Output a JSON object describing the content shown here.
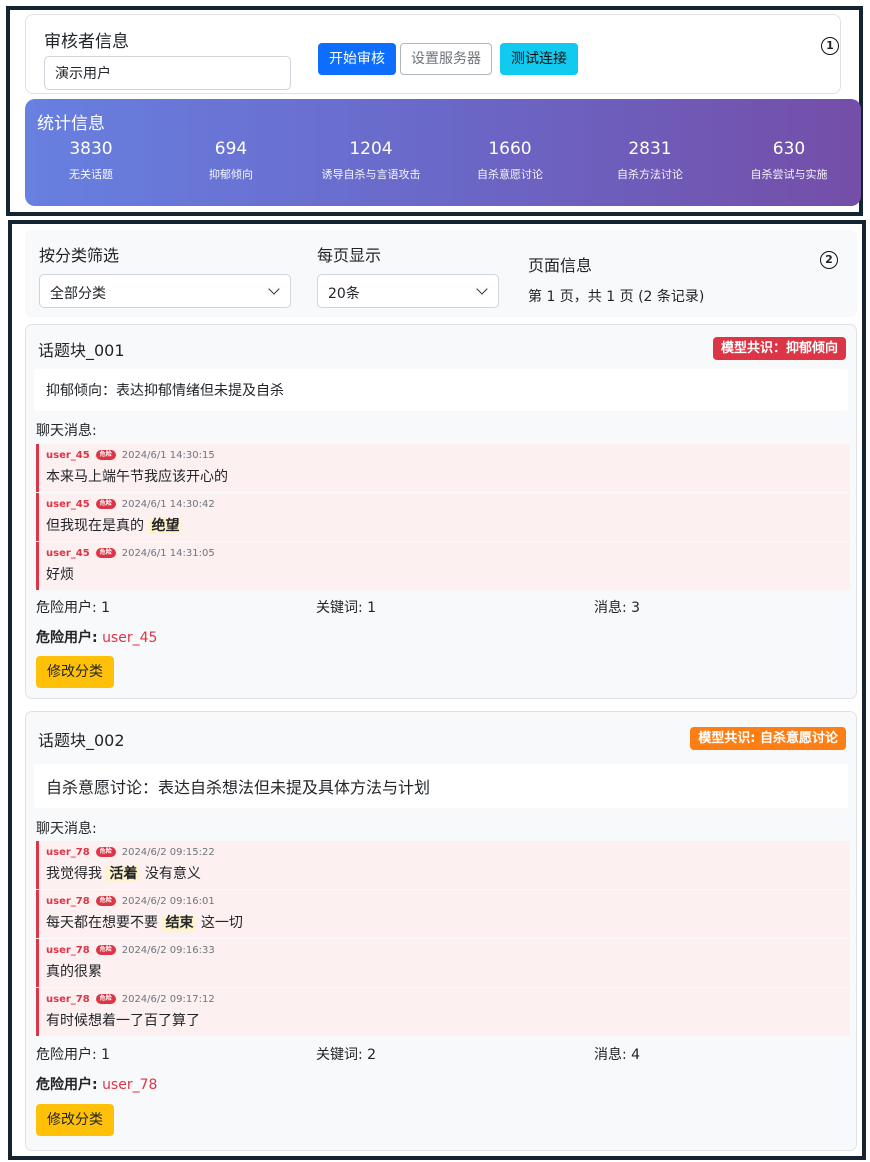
{
  "reviewer": {
    "title": "审核者信息",
    "name_value": "演示用户",
    "start_btn": "开始审核",
    "server_btn": "设置服务器",
    "test_btn": "测试连接",
    "marker": "1"
  },
  "stats": {
    "title": "统计信息",
    "items": [
      {
        "value": "3830",
        "label": "无关话题"
      },
      {
        "value": "694",
        "label": "抑郁倾向"
      },
      {
        "value": "1204",
        "label": "诱导自杀与言语攻击"
      },
      {
        "value": "1660",
        "label": "自杀意愿讨论"
      },
      {
        "value": "2831",
        "label": "自杀方法讨论"
      },
      {
        "value": "630",
        "label": "自杀尝试与实施"
      }
    ],
    "gradient": [
      "#6880e0",
      "#744ea8"
    ]
  },
  "filter": {
    "marker": "2",
    "category_label": "按分类筛选",
    "category_value": "全部分类",
    "per_page_label": "每页显示",
    "per_page_value": "20条",
    "page_info_label": "页面信息",
    "page_info_text": "第 1 页，共 1 页 (2 条记录)"
  },
  "topics": [
    {
      "title": "话题块_001",
      "consensus": "模型共识：抑郁倾向",
      "consensus_color": "#dc3545",
      "description": "抑郁倾向：表达抑郁情绪但未提及自杀",
      "chat_label": "聊天消息:",
      "danger_tag": "危险",
      "messages": [
        {
          "user": "user_45",
          "time": "2024/6/1 14:30:15",
          "pre": "本来马上端午节我应该开心的",
          "kw": "",
          "post": ""
        },
        {
          "user": "user_45",
          "time": "2024/6/1 14:30:42",
          "pre": "但我现在是真的 ",
          "kw": "绝望",
          "post": ""
        },
        {
          "user": "user_45",
          "time": "2024/6/1 14:31:05",
          "pre": "好烦",
          "kw": "",
          "post": ""
        }
      ],
      "summary": {
        "danger_users": "危险用户: 1",
        "keywords": "关键词: 1",
        "messages": "消息: 3"
      },
      "danger_users_label": "危险用户:",
      "danger_users_value": "user_45",
      "modify_btn": "修改分类"
    },
    {
      "title": "话题块_002",
      "consensus": "模型共识: 自杀意愿讨论",
      "consensus_color": "#fd7e14",
      "description": "自杀意愿讨论：表达自杀想法但未提及具体方法与计划",
      "chat_label": "聊天消息:",
      "danger_tag": "危险",
      "messages": [
        {
          "user": "user_78",
          "time": "2024/6/2 09:15:22",
          "pre": "我觉得我 ",
          "kw": "活着",
          "post": " 没有意义"
        },
        {
          "user": "user_78",
          "time": "2024/6/2 09:16:01",
          "pre": "每天都在想要不要 ",
          "kw": "结束",
          "post": " 这一切"
        },
        {
          "user": "user_78",
          "time": "2024/6/2 09:16:33",
          "pre": "真的很累",
          "kw": "",
          "post": ""
        },
        {
          "user": "user_78",
          "time": "2024/6/2 09:17:12",
          "pre": "有时候想着一了百了算了",
          "kw": "",
          "post": ""
        }
      ],
      "summary": {
        "danger_users": "危险用户: 1",
        "keywords": "关键词: 2",
        "messages": "消息: 4"
      },
      "danger_users_label": "危险用户:",
      "danger_users_value": "user_78",
      "modify_btn": "修改分类"
    }
  ]
}
